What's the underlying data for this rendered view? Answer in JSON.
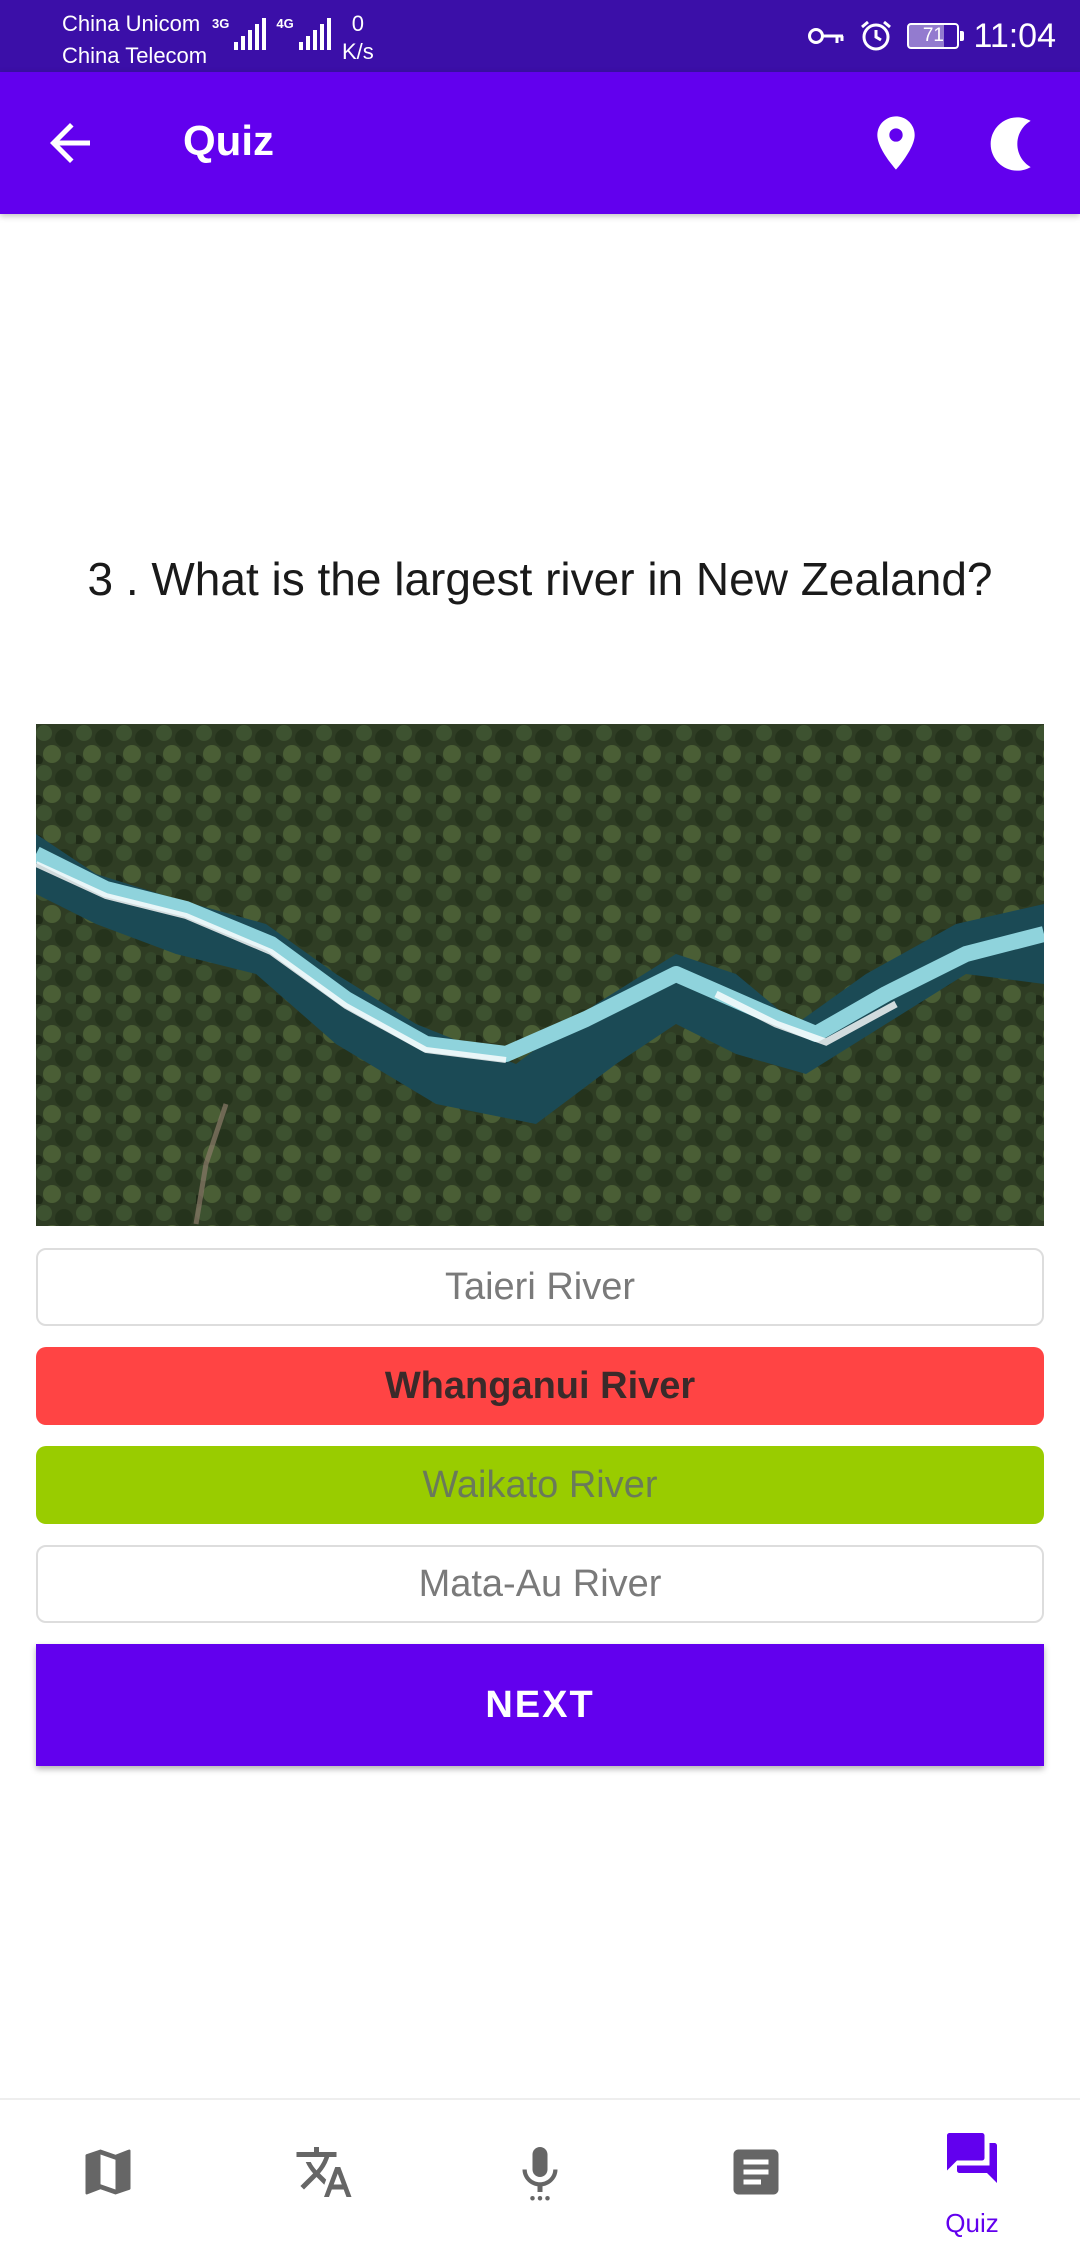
{
  "status_bar": {
    "carrier_1": "China Unicom",
    "carrier_2": "China Telecom",
    "net_type_1": "3G",
    "net_type_2": "4G",
    "speed_value": "0",
    "speed_unit": "K/s",
    "battery_level": "71",
    "time": "11:04"
  },
  "app_bar": {
    "title": "Quiz",
    "icons": [
      "arrow-back-icon",
      "location-pin-icon",
      "moon-icon"
    ]
  },
  "quiz": {
    "question": "3 . What is the largest river in New Zealand?",
    "options": [
      {
        "label": "Taieri River",
        "state": "neutral"
      },
      {
        "label": "Whanganui River",
        "state": "wrong"
      },
      {
        "label": "Waikato River",
        "state": "correct"
      },
      {
        "label": "Mata-Au River",
        "state": "neutral"
      }
    ],
    "next_label": "NEXT"
  },
  "colors": {
    "primary": "#6200ee",
    "status_bar": "#3b0fa8",
    "wrong": "#ff4444",
    "correct": "#99cc00"
  },
  "bottom_nav": {
    "items": [
      {
        "icon": "map-icon",
        "label": ""
      },
      {
        "icon": "translate-icon",
        "label": ""
      },
      {
        "icon": "microphone-icon",
        "label": ""
      },
      {
        "icon": "article-icon",
        "label": ""
      },
      {
        "icon": "forum-icon",
        "label": "Quiz",
        "active": true
      }
    ]
  }
}
